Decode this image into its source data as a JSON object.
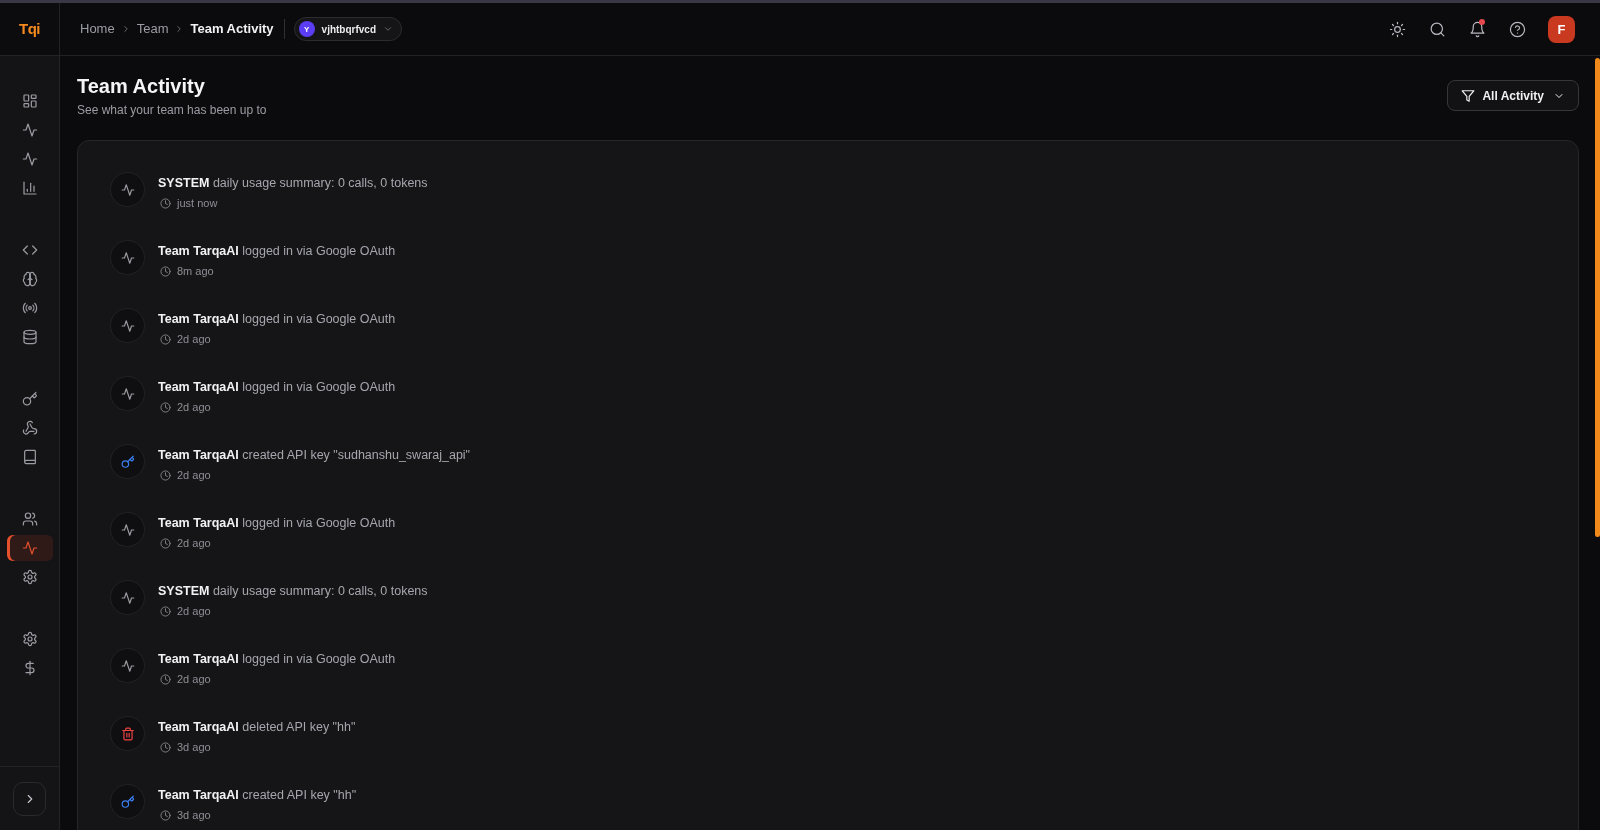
{
  "header": {
    "breadcrumb": [
      {
        "label": "Home",
        "current": false
      },
      {
        "label": "Team",
        "current": false
      },
      {
        "label": "Team Activity",
        "current": true
      }
    ],
    "workspace": {
      "initial": "Y",
      "name": "vjhtbqrfvcd"
    },
    "notifications": {
      "unread": true
    },
    "user": {
      "initial": "F"
    }
  },
  "sidebar": {
    "logo": "Tqi",
    "groups": [
      {
        "items": [
          {
            "kind": "dashboard",
            "selected": false
          },
          {
            "kind": "activity",
            "selected": false
          },
          {
            "kind": "activity",
            "selected": false
          },
          {
            "kind": "chart",
            "selected": false
          }
        ]
      },
      {
        "items": [
          {
            "kind": "code",
            "selected": false
          },
          {
            "kind": "brain",
            "selected": false
          },
          {
            "kind": "broadcast",
            "selected": false
          },
          {
            "kind": "database",
            "selected": false
          }
        ]
      },
      {
        "items": [
          {
            "kind": "key",
            "selected": false
          },
          {
            "kind": "webhook",
            "selected": false
          },
          {
            "kind": "book",
            "selected": false
          }
        ]
      },
      {
        "items": [
          {
            "kind": "users",
            "selected": false
          },
          {
            "kind": "activity",
            "selected": true
          },
          {
            "kind": "settings",
            "selected": false
          }
        ]
      },
      {
        "items": [
          {
            "kind": "settings",
            "selected": false
          },
          {
            "kind": "dollar",
            "selected": false
          }
        ]
      }
    ]
  },
  "page": {
    "title": "Team Activity",
    "subtitle": "See what your team has been up to",
    "filter": {
      "label": "All Activity"
    }
  },
  "activities": [
    {
      "kind": "activity",
      "message": "**SYSTEM** daily usage summary: 0 calls, 0 tokens",
      "time": "just now"
    },
    {
      "kind": "activity",
      "message": "**Team TarqaAI** logged in via Google OAuth",
      "time": "8m ago"
    },
    {
      "kind": "activity",
      "message": "**Team TarqaAI** logged in via Google OAuth",
      "time": "2d ago"
    },
    {
      "kind": "activity",
      "message": "**Team TarqaAI** logged in via Google OAuth",
      "time": "2d ago"
    },
    {
      "kind": "key",
      "message": "**Team TarqaAI** created API key \"sudhanshu_swaraj_api\"",
      "time": "2d ago"
    },
    {
      "kind": "activity",
      "message": "**Team TarqaAI** logged in via Google OAuth",
      "time": "2d ago"
    },
    {
      "kind": "activity",
      "message": "**SYSTEM** daily usage summary: 0 calls, 0 tokens",
      "time": "2d ago"
    },
    {
      "kind": "activity",
      "message": "**Team TarqaAI** logged in via Google OAuth",
      "time": "2d ago"
    },
    {
      "kind": "delete",
      "message": "**Team TarqaAI** deleted API key \"hh\"",
      "time": "3d ago"
    },
    {
      "kind": "key",
      "message": "**Team TarqaAI** created API key \"hh\"",
      "time": "3d ago"
    }
  ]
}
